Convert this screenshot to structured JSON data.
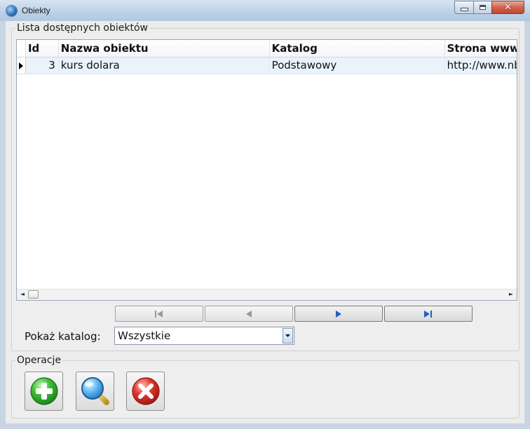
{
  "window": {
    "title": "Obiekty"
  },
  "groups": {
    "objects_title": "Lista dostępnych obiektów",
    "operations_title": "Operacje"
  },
  "grid": {
    "columns": [
      {
        "key": "id",
        "label": "Id"
      },
      {
        "key": "name",
        "label": "Nazwa obiektu"
      },
      {
        "key": "catalog",
        "label": "Katalog"
      },
      {
        "key": "url",
        "label": "Strona www"
      }
    ],
    "rows": [
      {
        "id": "3",
        "name": "kurs dolara",
        "catalog": "Podstawowy",
        "url": "http://www.nbp.pl"
      }
    ]
  },
  "filter": {
    "label": "Pokaż katalog:",
    "selected": "Wszystkie"
  },
  "icons": {
    "nav_first": "first-record-icon",
    "nav_prev": "previous-record-icon",
    "nav_next": "next-record-icon",
    "nav_last": "last-record-icon",
    "add": "add-icon",
    "search": "search-icon",
    "delete": "delete-icon"
  },
  "colors": {
    "nav_active": "#1f5fbf",
    "nav_disabled": "#9a9a9a",
    "add_green": "#2fae2f",
    "delete_red": "#d62a2a",
    "search_blue": "#2f8fd8"
  }
}
